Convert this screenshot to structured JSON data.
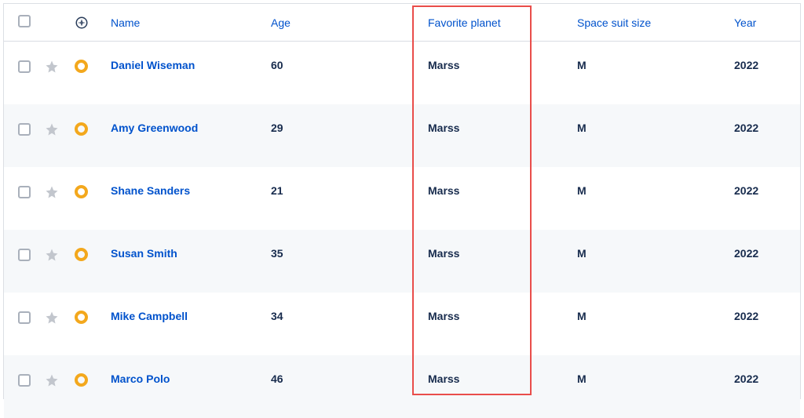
{
  "columns": {
    "name": "Name",
    "age": "Age",
    "planet": "Favorite planet",
    "size": "Space suit size",
    "year": "Year"
  },
  "rows": [
    {
      "name": "Daniel Wiseman",
      "age": "60",
      "planet": "Marss",
      "size": "M",
      "year": "2022"
    },
    {
      "name": "Amy Greenwood",
      "age": "29",
      "planet": "Marss",
      "size": "M",
      "year": "2022"
    },
    {
      "name": "Shane Sanders",
      "age": "21",
      "planet": "Marss",
      "size": "M",
      "year": "2022"
    },
    {
      "name": "Susan Smith",
      "age": "35",
      "planet": "Marss",
      "size": "M",
      "year": "2022"
    },
    {
      "name": "Mike Campbell",
      "age": "34",
      "planet": "Marss",
      "size": "M",
      "year": "2022"
    },
    {
      "name": "Marco Polo",
      "age": "46",
      "planet": "Marss",
      "size": "M",
      "year": "2022"
    }
  ],
  "highlighted_column": "planet"
}
